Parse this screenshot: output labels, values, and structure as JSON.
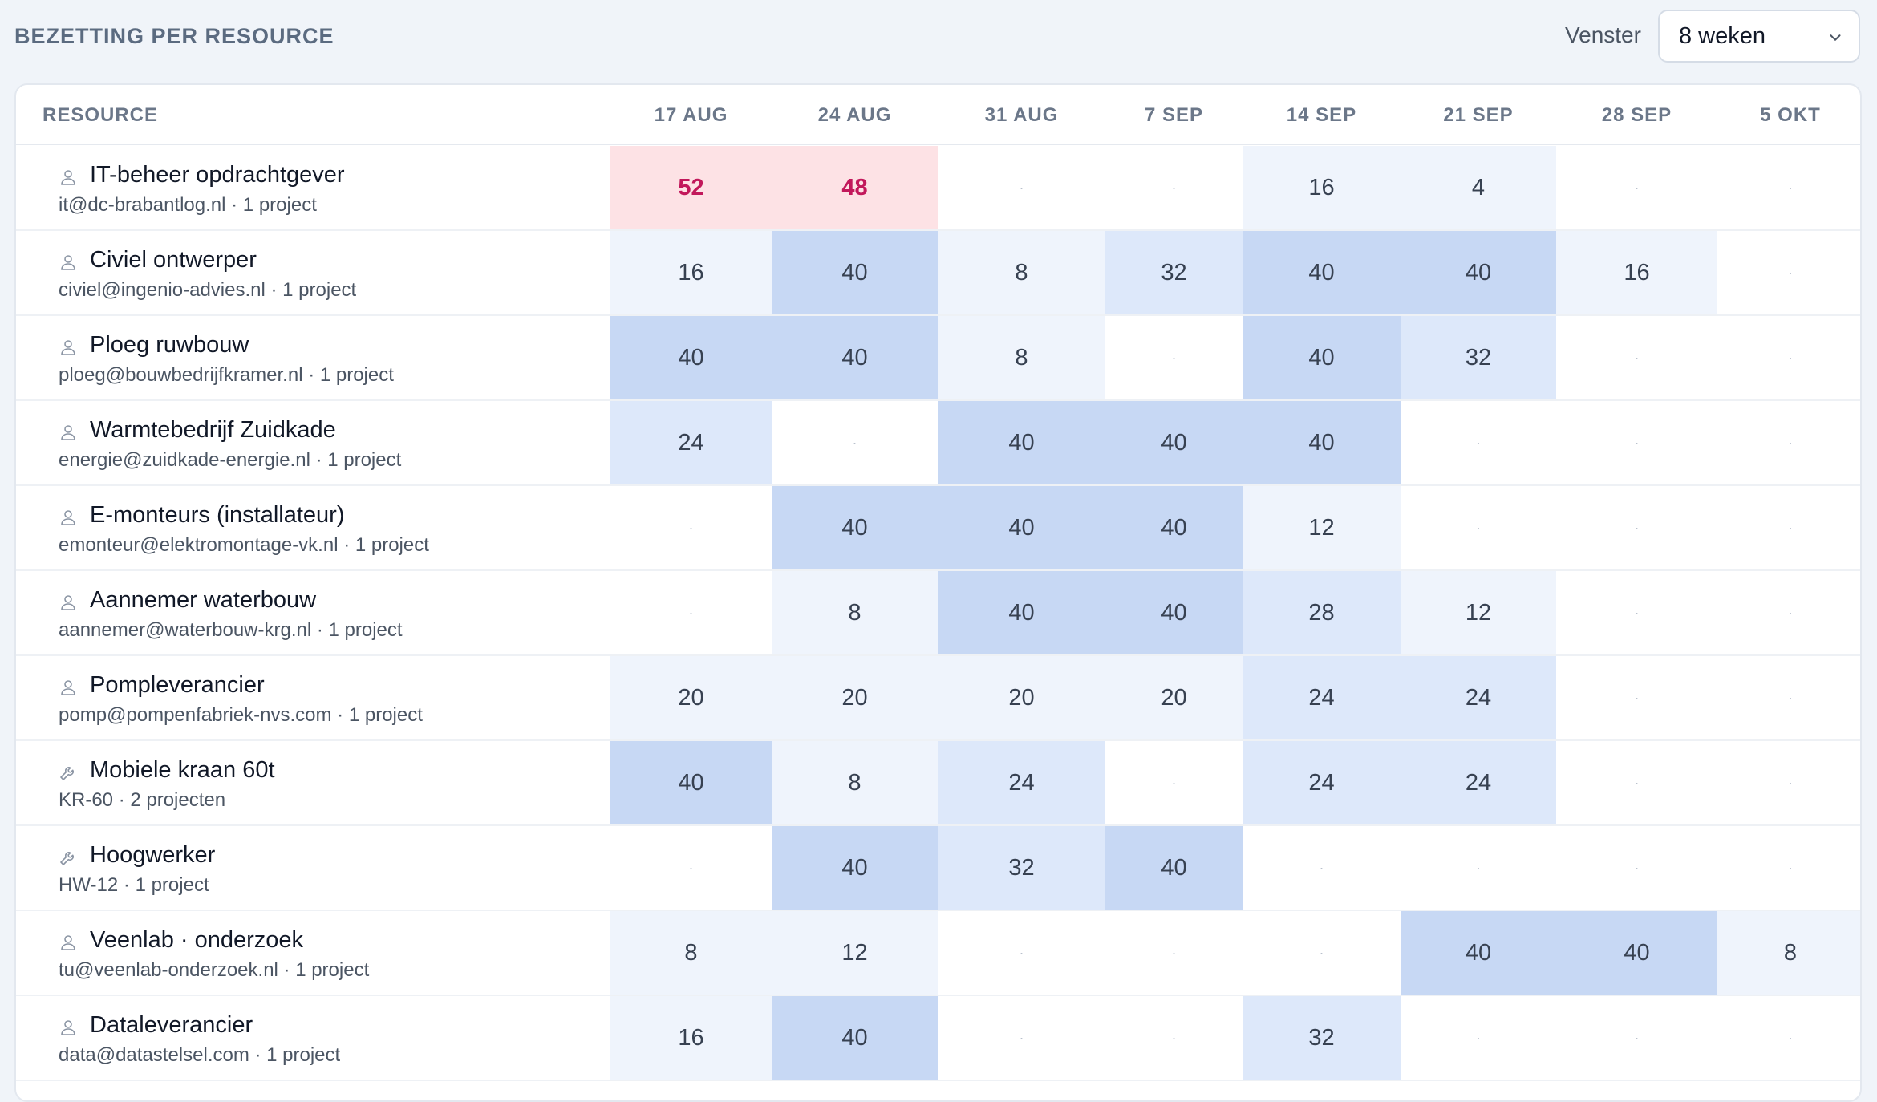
{
  "page": {
    "title": "BEZETTING PER RESOURCE",
    "window_label": "Venster",
    "window_value": "8 weken"
  },
  "table": {
    "resource_header": "RESOURCE",
    "weeks": [
      "17 AUG",
      "24 AUG",
      "31 AUG",
      "7 SEP",
      "14 SEP",
      "21 SEP",
      "28 SEP",
      "5 OKT"
    ],
    "empty_glyph": "·",
    "rows": [
      {
        "name": "IT-beheer opdrachtgever",
        "sub": "it@dc-brabantlog.nl · 1 project",
        "icon": "person-icon",
        "hours": [
          52,
          48,
          null,
          null,
          16,
          4,
          null,
          null
        ]
      },
      {
        "name": "Civiel ontwerper",
        "sub": "civiel@ingenio-advies.nl · 1 project",
        "icon": "person-icon",
        "hours": [
          16,
          40,
          8,
          32,
          40,
          40,
          16,
          null
        ]
      },
      {
        "name": "Ploeg ruwbouw",
        "sub": "ploeg@bouwbedrijfkramer.nl · 1 project",
        "icon": "person-icon",
        "hours": [
          40,
          40,
          8,
          null,
          40,
          32,
          null,
          null
        ]
      },
      {
        "name": "Warmtebedrijf Zuidkade",
        "sub": "energie@zuidkade-energie.nl · 1 project",
        "icon": "person-icon",
        "hours": [
          24,
          null,
          40,
          40,
          40,
          null,
          null,
          null
        ]
      },
      {
        "name": "E-monteurs (installateur)",
        "sub": "emonteur@elektromontage-vk.nl · 1 project",
        "icon": "person-icon",
        "hours": [
          null,
          40,
          40,
          40,
          12,
          null,
          null,
          null
        ]
      },
      {
        "name": "Aannemer waterbouw",
        "sub": "aannemer@waterbouw-krg.nl · 1 project",
        "icon": "person-icon",
        "hours": [
          null,
          8,
          40,
          40,
          28,
          12,
          null,
          null
        ]
      },
      {
        "name": "Pompleverancier",
        "sub": "pomp@pompenfabriek-nvs.com · 1 project",
        "icon": "person-icon",
        "hours": [
          20,
          20,
          20,
          20,
          24,
          24,
          null,
          null
        ]
      },
      {
        "name": "Mobiele kraan 60t",
        "sub": "KR-60 · 2 projecten",
        "icon": "wrench-icon",
        "hours": [
          40,
          8,
          24,
          null,
          24,
          24,
          null,
          null
        ]
      },
      {
        "name": "Hoogwerker",
        "sub": "HW-12 · 1 project",
        "icon": "wrench-icon",
        "hours": [
          null,
          40,
          32,
          40,
          null,
          null,
          null,
          null
        ]
      },
      {
        "name": "Veenlab · onderzoek",
        "sub": "tu@veenlab-onderzoek.nl · 1 project",
        "icon": "person-icon",
        "hours": [
          8,
          12,
          null,
          null,
          null,
          40,
          40,
          8
        ]
      },
      {
        "name": "Dataleverancier",
        "sub": "data@datastelsel.com · 1 project",
        "icon": "person-icon",
        "hours": [
          16,
          40,
          null,
          null,
          32,
          null,
          null,
          null
        ]
      }
    ]
  },
  "colors": {
    "over_bg": "#fde2e5",
    "over_text": "#c2185b",
    "high_bg": "#c7d8f4",
    "mid_bg": "#dde8fa",
    "low_bg": "#eff4fc"
  }
}
